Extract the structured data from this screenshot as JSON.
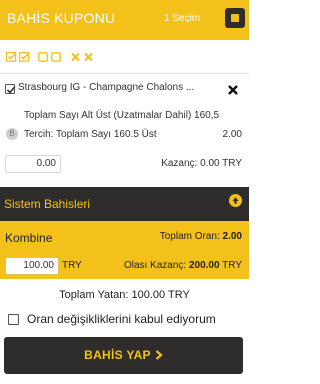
{
  "header": {
    "title": "BAHİS KUPONU",
    "count": "1 Seçim"
  },
  "toolbar": {
    "icons": [
      "edit-check-icon",
      "edit-check-icon",
      "square-icon",
      "square-icon",
      "x-icon",
      "x-icon"
    ]
  },
  "bet": {
    "match_name": "Strasbourg IG - Champagne Chalons ...",
    "market": "Toplam Sayı Alt Üst (Uzatmalar Dahil) 160,5",
    "badge": "B",
    "selection": "Tercih: Toplam Sayı 160.5 Üst",
    "odd": "2.00",
    "stake": "0.00",
    "winnings": "Kazanç: 0.00 TRY"
  },
  "system": {
    "label": "Sistem Bahisleri"
  },
  "combo": {
    "label": "Kombine",
    "total_odds_label": "Toplam Oran: ",
    "total_odds_value": "2.00",
    "amount": "100.00",
    "currency": "TRY",
    "potential_label": "Olası Kazanç: ",
    "potential_value": "200.00",
    "potential_currency": "TRY"
  },
  "total_stake": "Toplam Yatan: 100.00 TRY",
  "accept_odds_label": "Oran değişikliklerini kabul ediyorum",
  "submit_label": "BAHİS YAP",
  "colors": {
    "accent": "#f4c01a",
    "dark": "#2e2d2b"
  }
}
